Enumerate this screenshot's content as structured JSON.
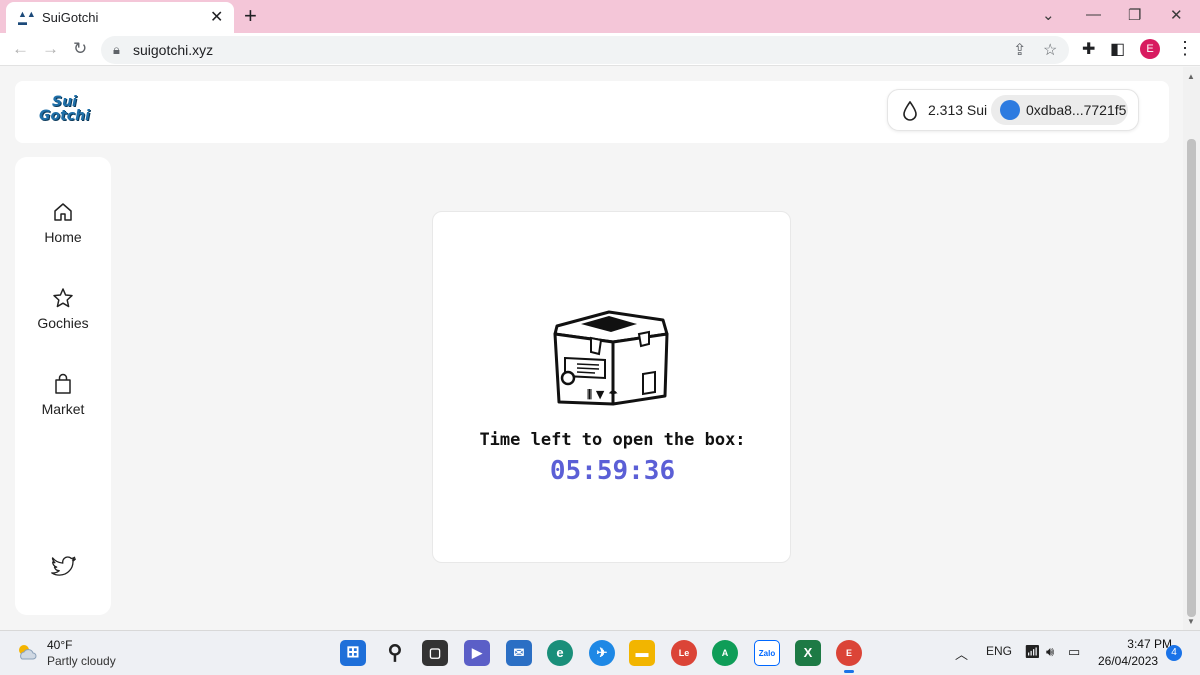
{
  "browser": {
    "tab_title": "SuiGotchi",
    "url": "suigotchi.xyz",
    "profile_initial": "E"
  },
  "app": {
    "logo_line1": "Sui",
    "logo_line2": "Gotchi",
    "balance": "2.313 Sui",
    "address": "0xdba8...7721f5"
  },
  "sidebar": {
    "items": [
      {
        "label": "Home",
        "icon": "home-icon"
      },
      {
        "label": "Gochies",
        "icon": "star-icon"
      },
      {
        "label": "Market",
        "icon": "shopping-bag-icon"
      }
    ],
    "social_icon": "twitter-icon"
  },
  "box_card": {
    "label": "Time left to open the box:",
    "timer": "05:59:36",
    "timer_color": "#5b5fd6"
  },
  "taskbar": {
    "temperature": "40°F",
    "condition": "Partly cloudy",
    "language": "ENG",
    "time": "3:47 PM",
    "date": "26/04/2023",
    "notifications": "4",
    "app_badges": {
      "chrome_1": "Le",
      "chrome_2": "A",
      "chrome_3": "E",
      "zalo": "Zalo",
      "excel": "X"
    }
  },
  "colors": {
    "tab_strip": "#f4c6d8",
    "accent": "#5b5fd6",
    "profile": "#d81b60"
  }
}
